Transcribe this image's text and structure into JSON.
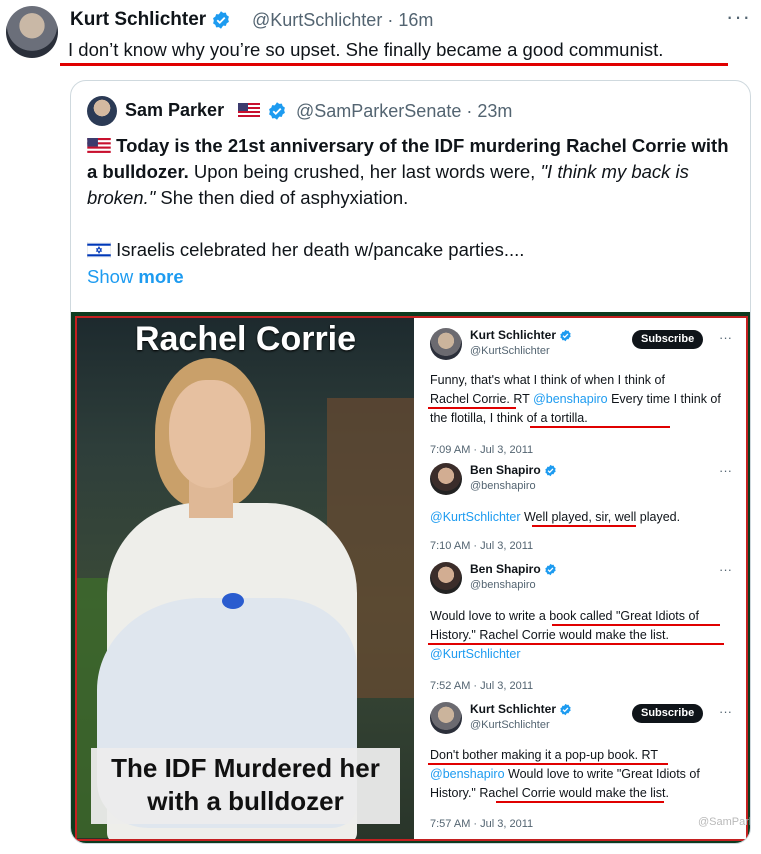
{
  "top_tweet": {
    "author_name": "Kurt Schlichter",
    "handle": "@KurtSchlichter",
    "time": "· 16m",
    "more": "···",
    "text": "I don’t know why you’re so upset. She finally became a good communist."
  },
  "quoted_tweet": {
    "author_name": "Sam Parker",
    "handle": "@SamParkerSenate",
    "time": "· 23m",
    "bold_text": "Today is the 21st anniversary of the IDF murdering Rachel Corrie with a bulldozer.",
    "text_1": " Upon being crushed, her last words were, ",
    "italic_text": "\"I think my back is broken.\"",
    "text_2": " She then died of asphyxiation.",
    "para_2": " Israelis celebrated her death w/pancake parties....",
    "show_more_1": "Show ",
    "show_more_2": "more"
  },
  "embedded_image": {
    "photo_title": "Rachel Corrie",
    "photo_caption": "The IDF Murdered her with a bulldozer",
    "watermark": "@SamParkerSenate",
    "tweets": [
      {
        "name": "Kurt Schlichter",
        "handle": "@KurtSchlichter",
        "subscribe": "Subscribe",
        "text_a": "Funny, that's what I think of when I think of",
        "text_b": "Rachel Corrie.",
        "text_c": " RT ",
        "link": "@benshapiro",
        "text_d": " Every time I think of the flotilla,",
        "text_e": " I think of a tortilla.",
        "time": "7:09 AM · Jul 3, 2011"
      },
      {
        "name": "Ben Shapiro",
        "handle": "@benshapiro",
        "link": "@KurtSchlichter",
        "text": " Well played, sir, well played.",
        "time": "7:10 AM · Jul 3, 2011"
      },
      {
        "name": "Ben Shapiro",
        "handle": "@benshapiro",
        "text_a": "Would love to write a book called \"Great Idiots of History.\" Rachel Corrie would make the list.",
        "link": "@KurtSchlichter",
        "time": "7:52 AM · Jul 3, 2011"
      },
      {
        "name": "Kurt Schlichter",
        "handle": "@KurtSchlichter",
        "subscribe": "Subscribe",
        "text_a": "Don't bother making it a pop-up book.",
        "text_b": " RT ",
        "link": "@benshapiro",
        "text_c": " Would love to write \"Great Idiots of History.\" Rachel Corrie would make the list.",
        "time": "7:57 AM · Jul 3, 2011"
      }
    ]
  },
  "colors": {
    "link": "#1d9bf0",
    "verified": "#1d9bf0",
    "underline": "#e00000",
    "secondary_text": "#536471"
  }
}
